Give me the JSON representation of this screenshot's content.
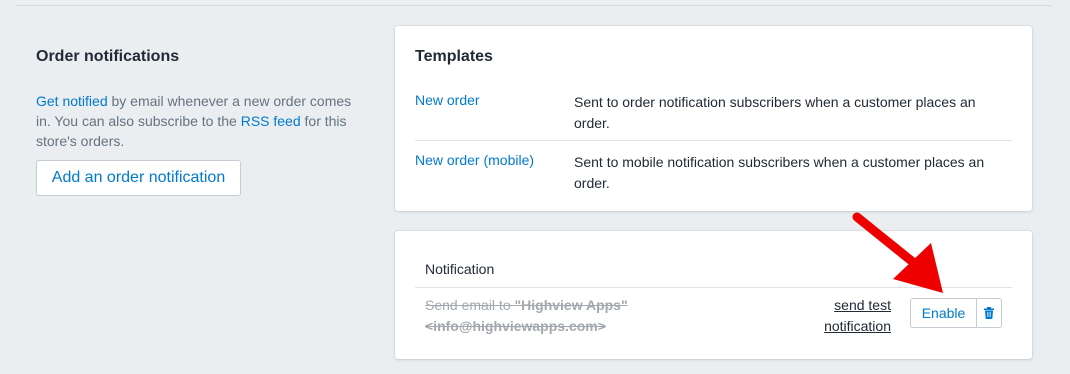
{
  "section": {
    "title": "Order notifications",
    "desc_link1": "Get notified",
    "desc_text1": " by email whenever a new order comes in. You can also subscribe to the ",
    "desc_link2": "RSS feed",
    "desc_text2": " for this store's orders.",
    "add_button": "Add an order notification"
  },
  "templates": {
    "title": "Templates",
    "rows": [
      {
        "name": "New order",
        "description": "Sent to order notification subscribers when a customer places an order."
      },
      {
        "name": "New order (mobile)",
        "description": "Sent to mobile notification subscribers when a customer places an order."
      }
    ]
  },
  "notifications": {
    "header": "Notification",
    "items": [
      {
        "email_prefix": "Send email to ",
        "email_name": "\"Highview Apps\"",
        "email_address": "<info@highviewapps.com>",
        "send_test_label": "send test notification",
        "enable_label": "Enable",
        "delete_icon": "trash-icon"
      }
    ]
  },
  "colors": {
    "accent": "#007ace",
    "background": "#ebeef0",
    "annotation_arrow": "#ee0000"
  }
}
